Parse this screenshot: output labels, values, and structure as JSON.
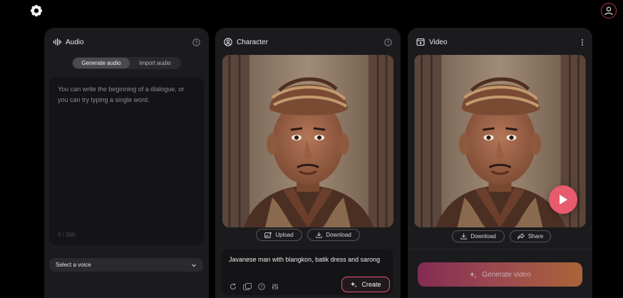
{
  "app": {
    "logo_icon": "flower-logo-icon",
    "account_icon": "user-avatar-icon"
  },
  "audio": {
    "title": "Audio",
    "tabs": [
      {
        "label": "Generate audio",
        "active": true
      },
      {
        "label": "Import audio",
        "active": false
      }
    ],
    "textarea_placeholder": "You can write the beginning of a dialogue, or you can try typing a single word.",
    "char_count": "0 / 300",
    "voice_select": "Select a voice"
  },
  "character": {
    "title": "Character",
    "upload_label": "Upload",
    "download_label": "Download",
    "prompt": "Javanese man with blangkon, batik dress and sarong",
    "create_label": "Create"
  },
  "video": {
    "title": "Video",
    "download_label": "Download",
    "share_label": "Share",
    "generate_label": "Generate video"
  },
  "colors": {
    "accent_pink": "#e8557a",
    "play_button": "#e85a6d",
    "panel_bg": "#1b1b1e"
  }
}
